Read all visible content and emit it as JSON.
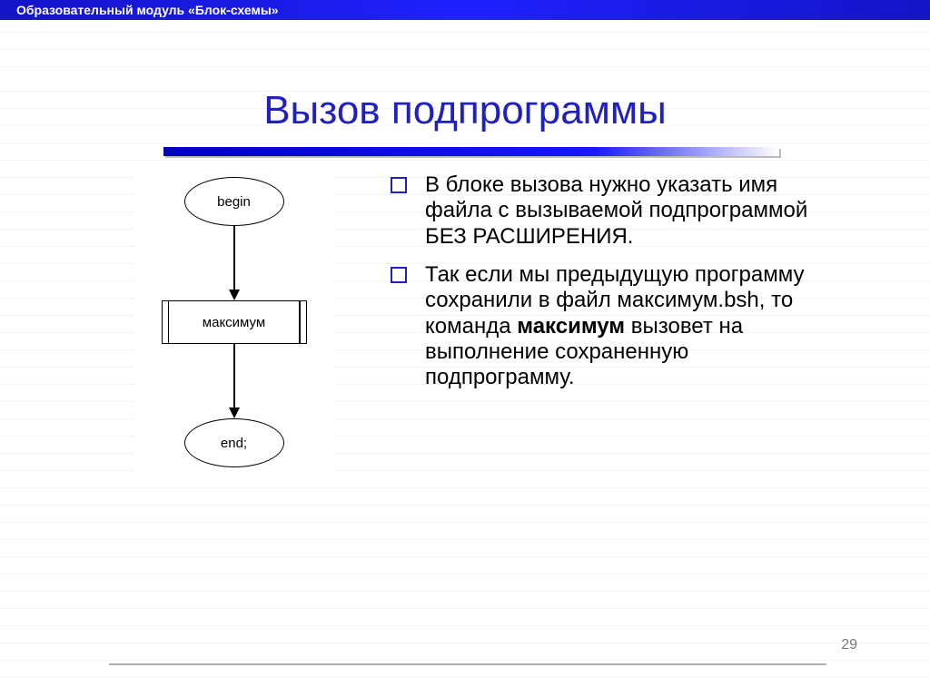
{
  "header": {
    "module_label": "Образовательный модуль «Блок-схемы»"
  },
  "title": "Вызов подпрограммы",
  "flowchart": {
    "begin": "begin",
    "process": "максимум",
    "end": "end;"
  },
  "bullets": {
    "item1": "В блоке вызова нужно указать имя файла с вызываемой подпрограммой БЕЗ РАСШИРЕНИЯ.",
    "item2_part1": "Так если мы предыдущую программу сохранили в файл максимум.bsh, то команда ",
    "item2_bold": "максимум",
    "item2_part2": " вызовет на выполнение сохраненную подпрограмму."
  },
  "page_number": "29"
}
